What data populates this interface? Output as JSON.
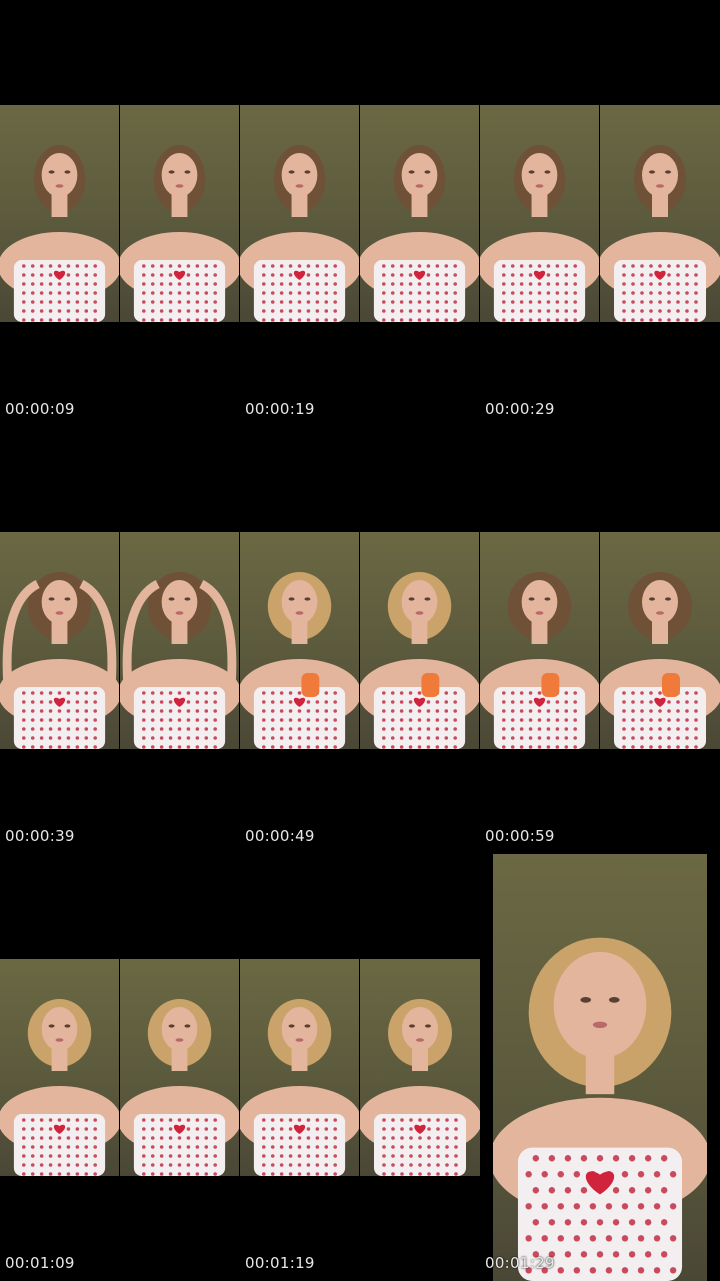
{
  "timestamps": [
    "00:00:09",
    "00:00:19",
    "00:00:29",
    "00:00:39",
    "00:00:49",
    "00:00:59",
    "00:01:09",
    "00:01:19",
    "00:01:29"
  ],
  "colors": {
    "background": "#000000",
    "wall": "#5e5c3e",
    "skin": "#e3b59c",
    "hair": "#6e5136",
    "hair_blonde": "#c9a36a",
    "top": "#f3eef0",
    "dot": "#c84a5c",
    "heart": "#d0243c",
    "orange_object": "#f07a3a",
    "timestamp_text": "#e8e8e8"
  }
}
